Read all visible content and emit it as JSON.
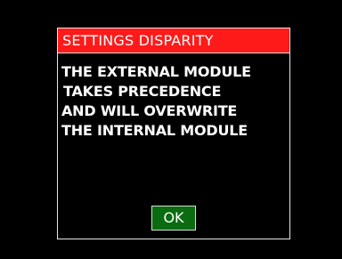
{
  "dialog": {
    "title": "SETTINGS DISPARITY",
    "message_lines": [
      "THE EXTERNAL MODULE",
      " TAKES PRECEDENCE",
      "AND WILL OVERWRITE",
      "THE INTERNAL MODULE"
    ],
    "ok_label": "OK"
  },
  "colors": {
    "background": "#000000",
    "title_bar": "#ff1a1a",
    "border": "#e6e6e6",
    "ok_button": "#0b6b10",
    "text": "#ffffff"
  }
}
